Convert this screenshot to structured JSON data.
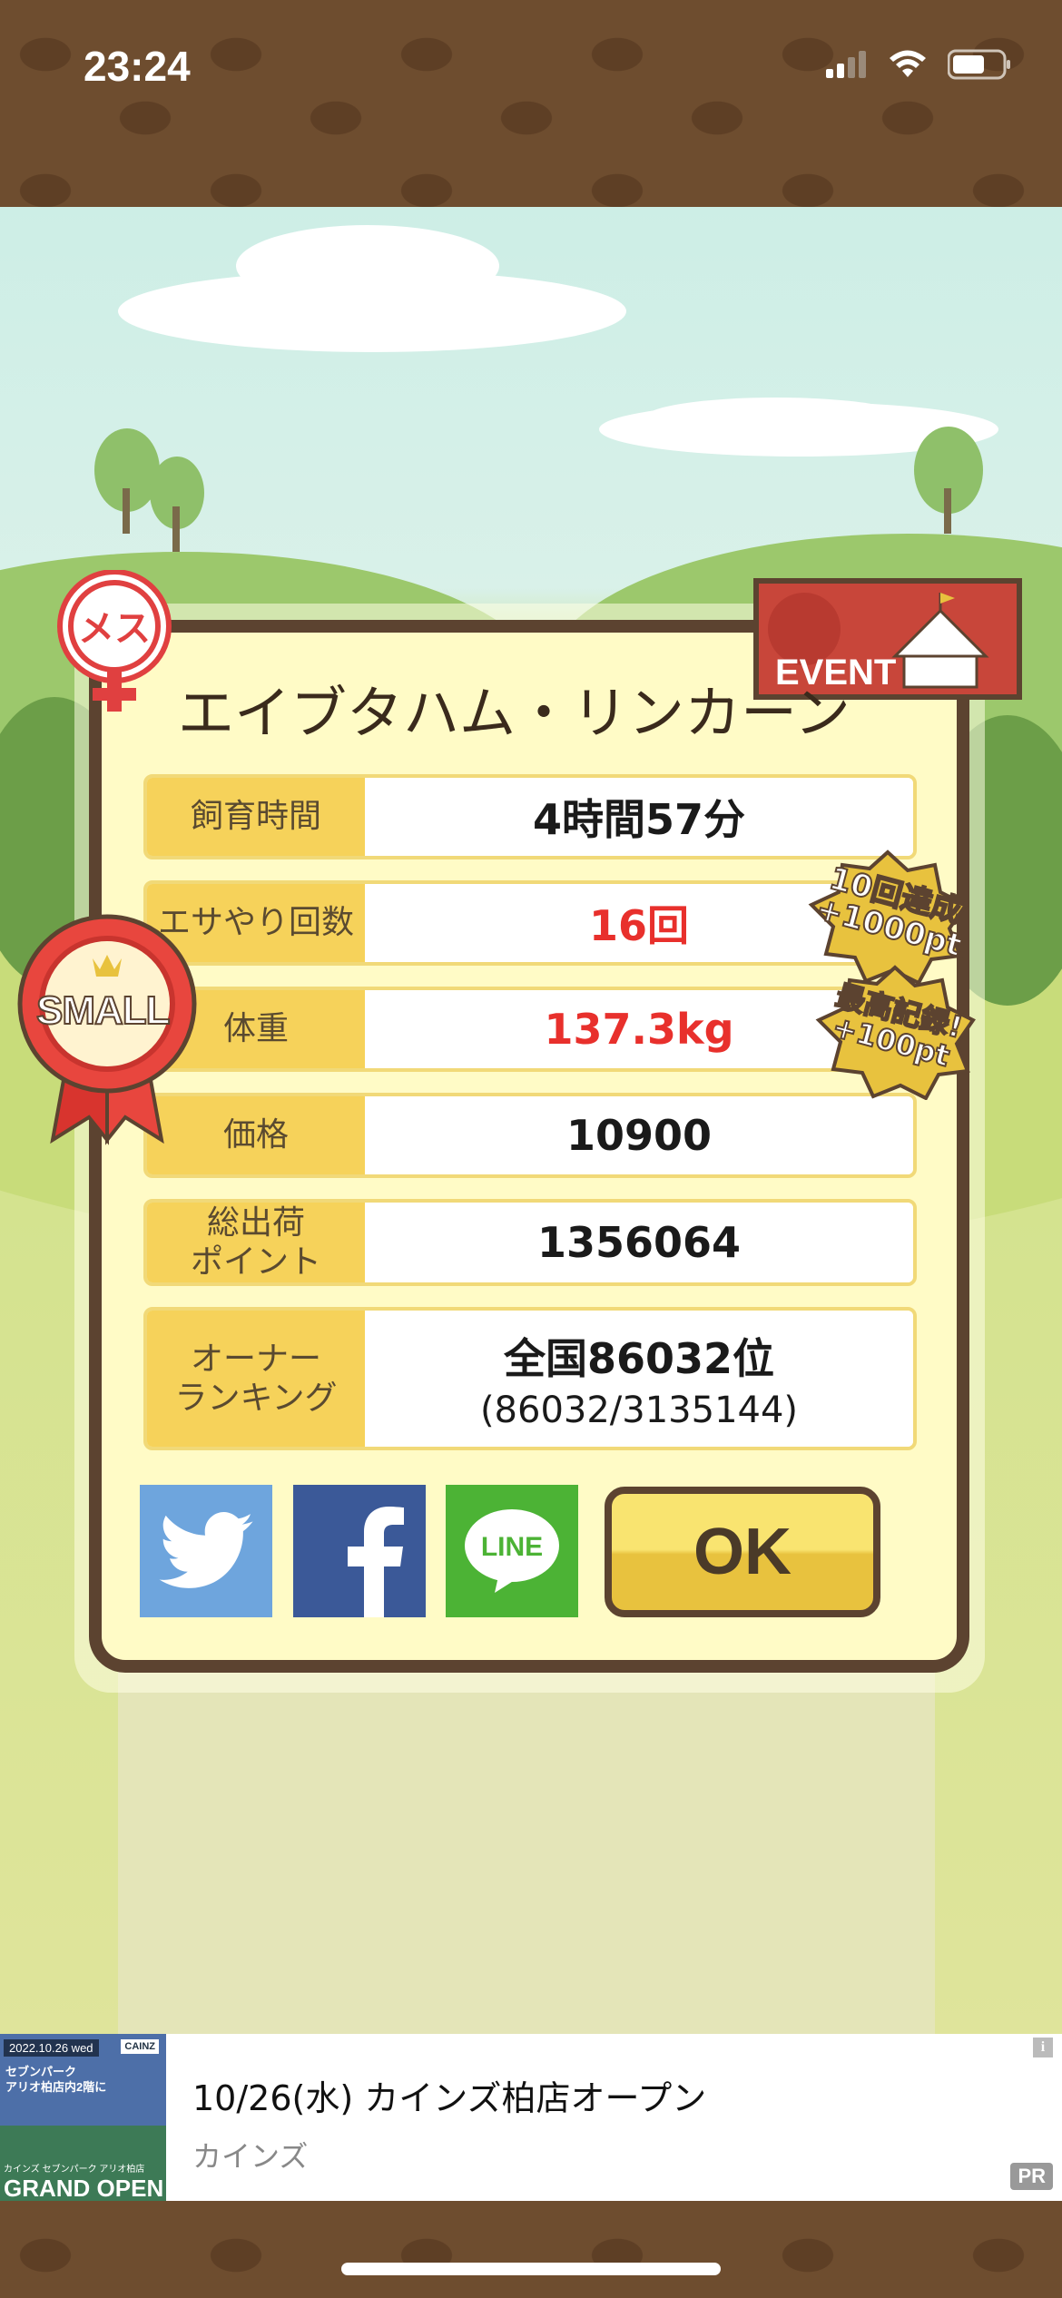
{
  "status_bar": {
    "time": "23:24",
    "signal_icon": "cellular-signal-icon",
    "wifi_icon": "wifi-icon",
    "battery_icon": "battery-icon"
  },
  "badges": {
    "gender": "メス",
    "event": "EVENT",
    "size": "SMALL",
    "achievement_1_line1": "10回達成",
    "achievement_1_line2": "+1000pt",
    "achievement_2_line1": "最高記録!",
    "achievement_2_line2": "+100pt"
  },
  "pet": {
    "name": "エイブタハム・リンカーン"
  },
  "stats": [
    {
      "label": "飼育時間",
      "value": "4時間57分"
    },
    {
      "label": "エサやり回数",
      "value": "16回"
    },
    {
      "label": "体重",
      "value": "137.3kg"
    },
    {
      "label": "価格",
      "value": "10900"
    },
    {
      "label": "総出荷\nポイント",
      "value": "1356064"
    },
    {
      "label": "オーナー\nランキング",
      "value": "全国86032位",
      "sub": "(86032/3135144)"
    }
  ],
  "share": {
    "twitter_icon": "twitter-icon",
    "facebook_icon": "facebook-icon",
    "line_label": "LINE"
  },
  "ok_button": {
    "label": "OK"
  },
  "ad": {
    "thumb_date": "2022.10.26 wed",
    "thumb_brand": "CAINZ",
    "thumb_line1": "セブンパーク",
    "thumb_line2": "アリオ柏店内2階に",
    "thumb_small": "カインズ セブンパーク アリオ柏店",
    "thumb_grand": "GRAND OPEN",
    "title": "10/26(水) カインズ柏店オープン",
    "sponsor": "カインズ",
    "pr_label": "PR",
    "info_label": "i"
  },
  "colors": {
    "accent_red": "#e8302c",
    "label_yellow": "#f6d25a",
    "frame_brown": "#5c4330",
    "twitter": "#6ea5dd",
    "facebook": "#3b5998",
    "line": "#4cb335"
  }
}
